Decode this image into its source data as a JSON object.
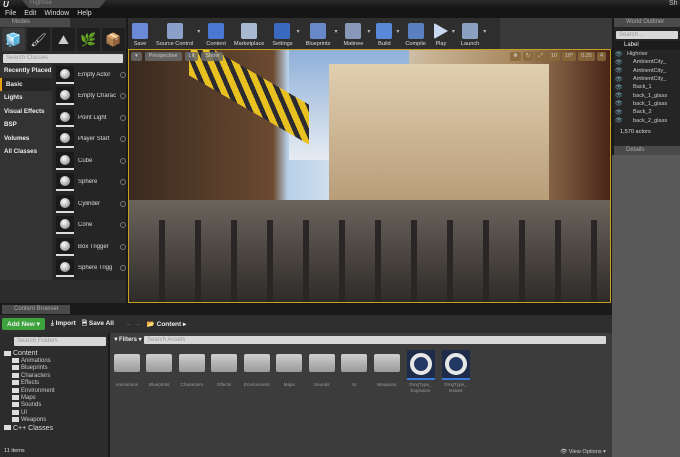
{
  "title_tab": "Highrise",
  "menu": [
    "File",
    "Edit",
    "Window",
    "Help"
  ],
  "modes": {
    "tab": "Modes",
    "search_placeholder": "Search Classes",
    "categories": [
      "Recently Placed",
      "Basic",
      "Lights",
      "Visual Effects",
      "BSP",
      "Volumes",
      "All Classes"
    ],
    "selected_category": "Basic",
    "classes": [
      "Empty Actor",
      "Empty Charac",
      "Point Light",
      "Player Start",
      "Cube",
      "Sphere",
      "Cylinder",
      "Cone",
      "Box Trigger",
      "Sphere Trigg"
    ]
  },
  "toolbar": [
    {
      "label": "Save",
      "color": "#6a8ad8"
    },
    {
      "label": "Source Control",
      "color": "#8aa0c8",
      "dd": true
    },
    {
      "label": "Content",
      "color": "#4a78d0"
    },
    {
      "label": "Marketplace",
      "color": "#a8b8d0"
    },
    {
      "label": "Settings",
      "color": "#3a6ac0",
      "dd": true
    },
    {
      "label": "Blueprints",
      "color": "#6888c8",
      "dd": true
    },
    {
      "label": "Matinee",
      "color": "#8898b8",
      "dd": true
    },
    {
      "label": "Build",
      "color": "#5a88d8",
      "dd": true
    },
    {
      "label": "Compile",
      "color": "#5a80c0"
    },
    {
      "label": "Play",
      "color": "#c8d8f0",
      "dd": true
    },
    {
      "label": "Launch",
      "color": "#8aa0c0",
      "dd": true
    }
  ],
  "viewport": {
    "perspective": "Perspective",
    "lit": "Lit",
    "show": "Show",
    "right_controls": [
      "10",
      "10°",
      "0.25",
      "4"
    ]
  },
  "outliner": {
    "tab": "World Outliner",
    "search_placeholder": "Search...",
    "column": "Label",
    "items": [
      "Highrise",
      "AmbientCity_",
      "AmbientCity_",
      "AmbientCity_",
      "Back_1",
      "back_1_glass",
      "back_1_glass",
      "Back_2",
      "back_2_glass"
    ],
    "count": "1,570 actors"
  },
  "details_tab": "Details",
  "content_browser": {
    "tab": "Content Browser",
    "add_new": "Add New",
    "import": "Import",
    "save_all": "Save All",
    "path": "Content",
    "search_folders": "Search Folders",
    "filters": "Filters",
    "search_assets": "Search Assets",
    "tree_root": "Content",
    "tree": [
      "Animations",
      "Blueprints",
      "Characters",
      "Effects",
      "Environment",
      "Maps",
      "Sounds",
      "UI",
      "Weapons"
    ],
    "cpp": "C++ Classes",
    "folders": [
      "Animations",
      "Blueprints",
      "Characters",
      "Effects",
      "Environment",
      "Maps",
      "Sounds",
      "UI",
      "Weapons"
    ],
    "assets": [
      "DmgType_ Explosion",
      "DmgType_ Instant"
    ],
    "item_count": "11 items",
    "view_options": "View Options"
  }
}
